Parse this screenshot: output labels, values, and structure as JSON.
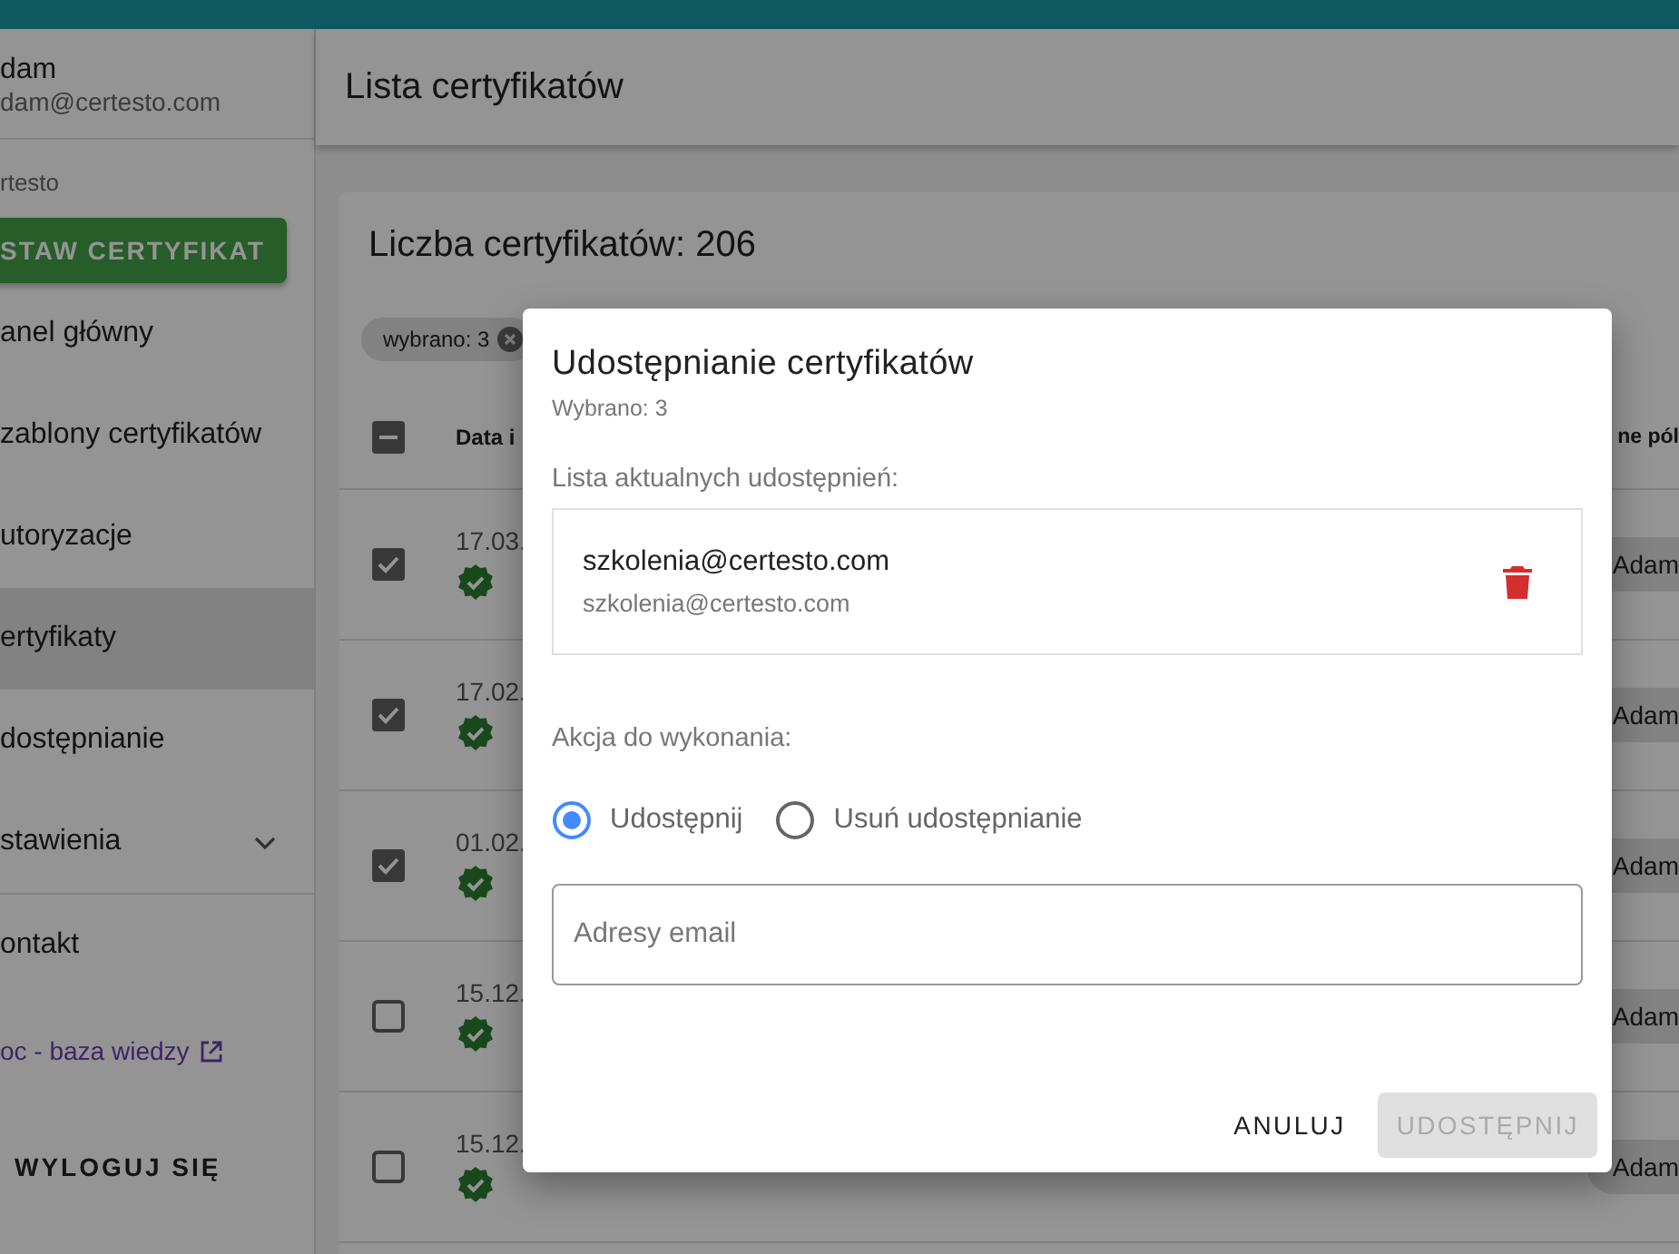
{
  "sidebar": {
    "user_name": "dam",
    "user_email": "dam@certesto.com",
    "org": "rtesto",
    "primary_button": "STAW CERTYFIKAT",
    "items": [
      {
        "kind": "item",
        "label": "anel główny",
        "selected": false
      },
      {
        "kind": "item",
        "label": "zablony certyfikatów",
        "selected": false
      },
      {
        "kind": "item",
        "label": "utoryzacje",
        "selected": false
      },
      {
        "kind": "item",
        "label": "ertyfikaty",
        "selected": true
      },
      {
        "kind": "item",
        "label": "dostępnianie",
        "selected": false
      },
      {
        "kind": "group",
        "label": "stawienia",
        "selected": false,
        "expanded": false
      },
      {
        "kind": "item",
        "label": "ontakt",
        "selected": false
      },
      {
        "kind": "link",
        "label": "oc - baza wiedzy",
        "selected": false
      }
    ],
    "logout": "WYLOGUJ SIĘ"
  },
  "header": {
    "title": "Lista certyfikatów"
  },
  "card": {
    "title": "Liczba certyfikatów: 206",
    "chip": "wybrano: 3",
    "table": {
      "columns": [
        {
          "label": "Data i"
        },
        {
          "label": "ne pól"
        }
      ],
      "header_checkbox": {
        "checked": false,
        "indeterminate": true
      },
      "rows": [
        {
          "checked": true,
          "date": "17.03.",
          "owner": "Adam"
        },
        {
          "checked": true,
          "date": "17.02.",
          "owner": "Adam"
        },
        {
          "checked": true,
          "date": "01.02.",
          "owner": "Adam"
        },
        {
          "checked": false,
          "date": "15.12.",
          "owner": "Adam"
        },
        {
          "checked": false,
          "date": "15.12.",
          "owner": "Adam"
        }
      ]
    }
  },
  "dialog": {
    "title": "Udostępnianie certyfikatów",
    "subtitle": "Wybrano: 3",
    "list_label": "Lista aktualnych udostępnień:",
    "shares": [
      {
        "primary": "szkolenia@certesto.com",
        "secondary": "szkolenia@certesto.com"
      }
    ],
    "action_label": "Akcja do wykonania:",
    "radios": [
      {
        "label": "Udostępnij",
        "selected": true
      },
      {
        "label": "Usuń udostępnianie",
        "selected": false
      }
    ],
    "email_field": {
      "placeholder": "Adresy email"
    },
    "buttons": [
      {
        "label": "ANULUJ",
        "kind": "text",
        "disabled": false
      },
      {
        "label": "UDOSTĘPNIJ",
        "kind": "filled",
        "disabled": true
      }
    ]
  }
}
